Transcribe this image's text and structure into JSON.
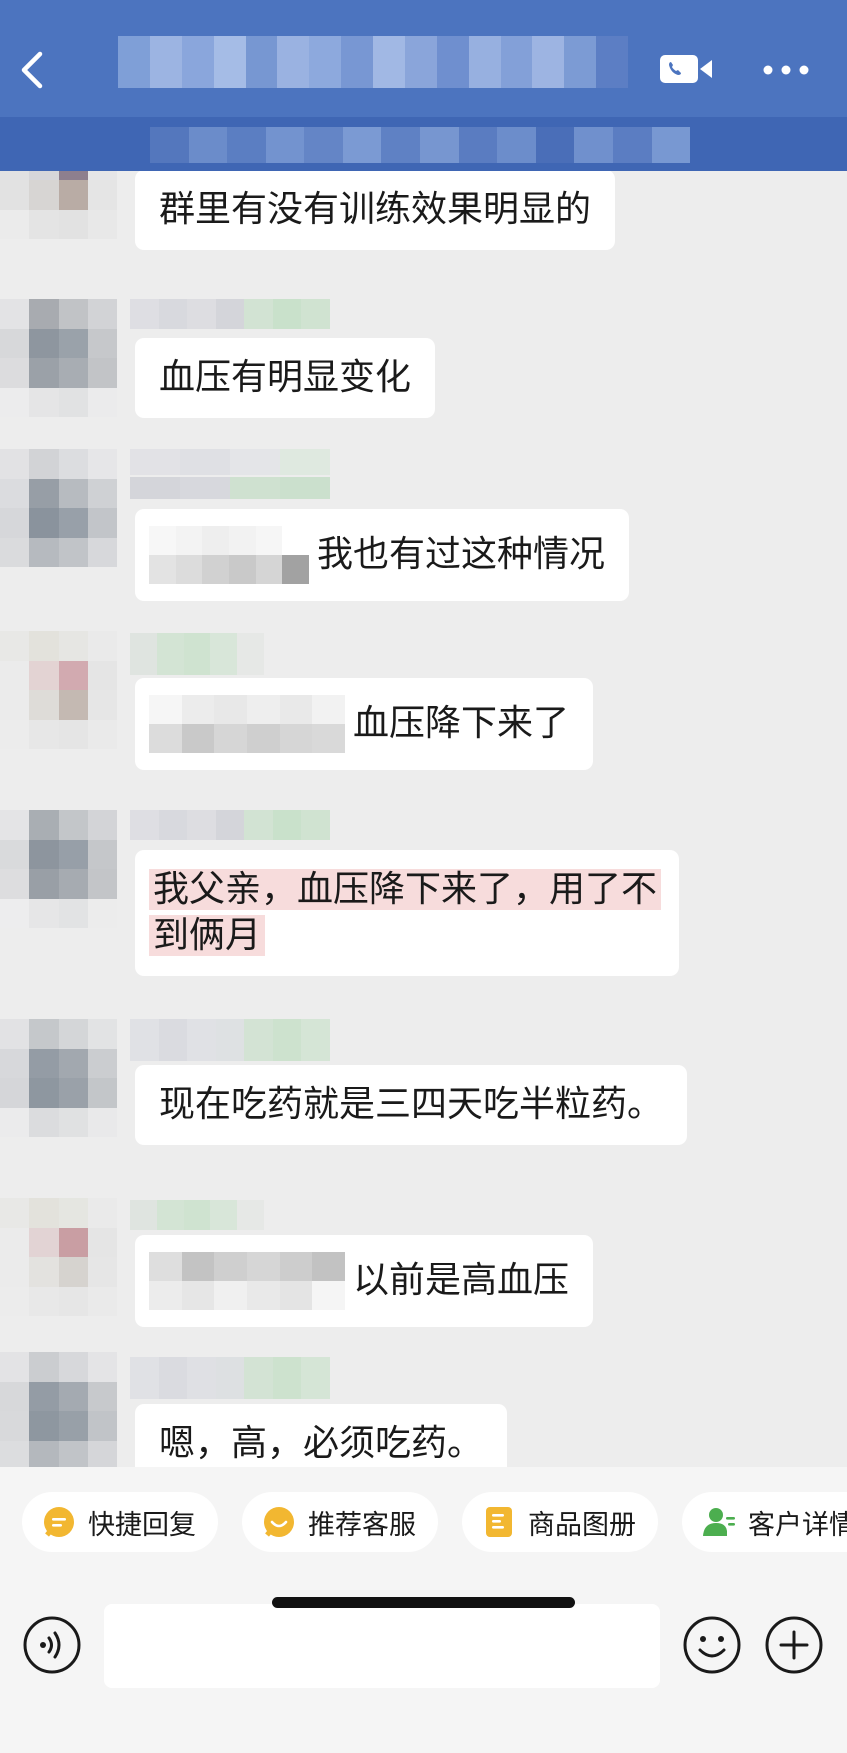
{
  "header": {
    "back_icon": "chevron-left-icon",
    "title": "",
    "video_icon": "video-call-icon",
    "more_icon": "more-dots-icon",
    "bg_color": "#4c74bf"
  },
  "messages": [
    {
      "text": "群里有没有训练效果明显的",
      "mention": false,
      "highlight": false
    },
    {
      "text": "血压有明显变化",
      "mention": false,
      "highlight": false
    },
    {
      "text": "我也有过这种情况",
      "mention": true,
      "highlight": false
    },
    {
      "text": "血压降下来了",
      "mention": true,
      "highlight": false
    },
    {
      "line1": "我父亲，血压降下来了，用了不",
      "line2": "到俩月",
      "mention": false,
      "highlight": true
    },
    {
      "text": "现在吃药就是三四天吃半粒药。",
      "mention": false,
      "highlight": false
    },
    {
      "text": "以前是高血压",
      "mention": true,
      "highlight": false
    },
    {
      "text": "嗯，高，必须吃药。",
      "mention": false,
      "highlight": false
    }
  ],
  "quick_actions": [
    {
      "label": "快捷回复",
      "icon": "quick-reply-icon",
      "color": "#f2b731"
    },
    {
      "label": "推荐客服",
      "icon": "recommend-service-icon",
      "color": "#f2b731"
    },
    {
      "label": "商品图册",
      "icon": "product-album-icon",
      "color": "#f2b731"
    },
    {
      "label": "客户详情",
      "icon": "customer-detail-icon",
      "color": "#4cae4f"
    }
  ],
  "input": {
    "value": "",
    "voice_icon": "voice-icon",
    "emoji_icon": "emoji-icon",
    "plus_icon": "plus-icon"
  }
}
